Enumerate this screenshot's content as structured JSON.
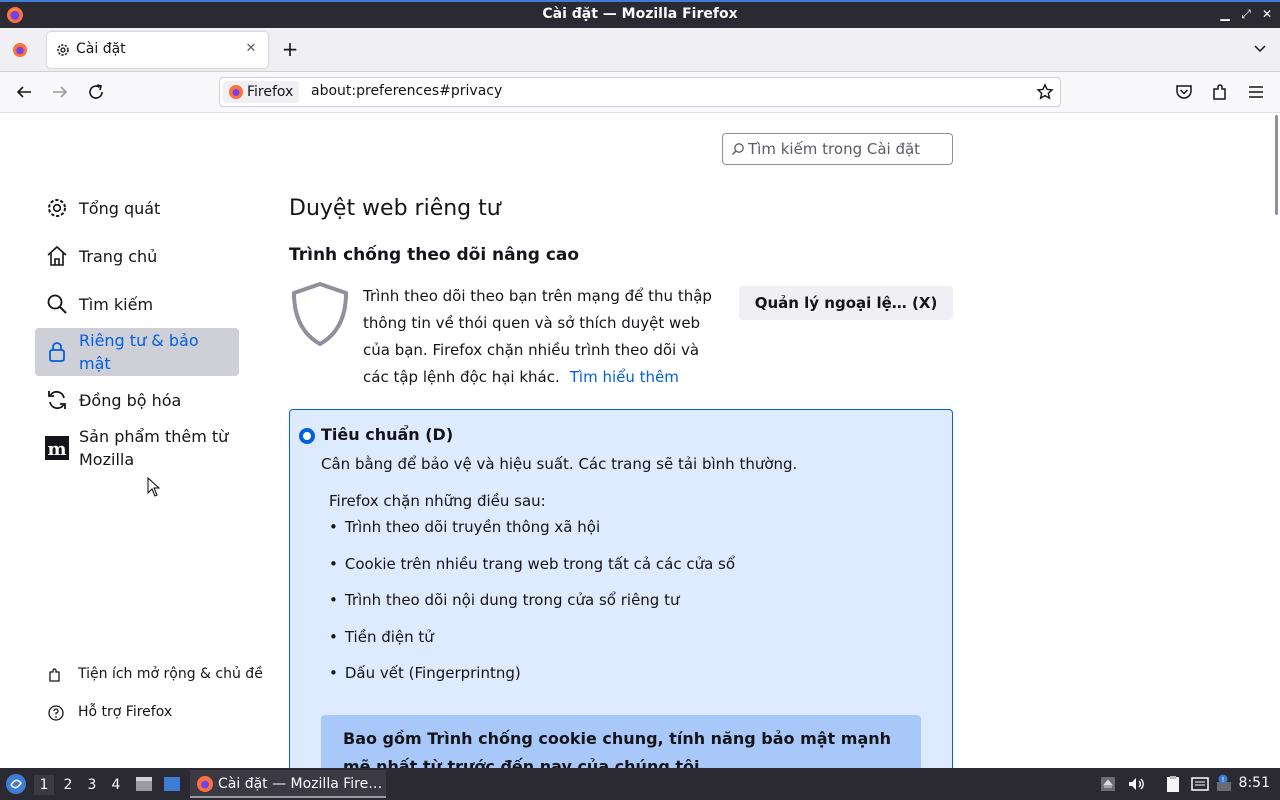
{
  "window": {
    "title": "Cài đặt — Mozilla Firefox"
  },
  "tabs": [
    {
      "label": "Cài đặt",
      "icon": "gear-icon",
      "active": true
    }
  ],
  "navbar": {
    "identity_label": "Firefox",
    "url": "about:preferences#privacy"
  },
  "search": {
    "placeholder": "Tìm kiếm trong Cài đặt"
  },
  "sidebar": {
    "categories": [
      {
        "label": "Tổng quát",
        "icon": "gear-icon"
      },
      {
        "label": "Trang chủ",
        "icon": "home-icon"
      },
      {
        "label": "Tìm kiếm",
        "icon": "search-icon"
      },
      {
        "label": "Riêng tư & bảo mật",
        "icon": "lock-icon",
        "selected": true
      },
      {
        "label": "Đồng bộ hóa",
        "icon": "sync-icon"
      },
      {
        "label": "Sản phẩm thêm từ Mozilla",
        "icon": "mozilla-m-icon"
      }
    ],
    "footer": [
      {
        "label": "Tiện ích mở rộng & chủ đề",
        "icon": "puzzle-icon"
      },
      {
        "label": "Hỗ trợ Firefox",
        "icon": "help-icon"
      }
    ]
  },
  "main": {
    "heading": "Duyệt web riêng tư",
    "subheading": "Trình chống theo dõi nâng cao",
    "description": "Trình theo dõi theo bạn trên mạng để thu thập thông tin về thói quen và sở thích duyệt web của bạn. Firefox chặn nhiều trình theo dõi và các tập lệnh độc hại khác.",
    "learn_more": "Tìm hiểu thêm",
    "manage_button": "Quản lý ngoại lệ… (X)",
    "standard": {
      "label": "Tiêu chuẩn (D)",
      "description": "Cân bằng để bảo vệ và hiệu suất. Các trang sẽ tải bình thường.",
      "blocks_intro": "Firefox chặn những điều sau:",
      "blocked_items": [
        "Trình theo dõi truyền thông xã hội",
        "Cookie trên nhiều trang web trong tất cả các cửa sổ",
        "Trình theo dõi nội dung trong cửa sổ riêng tư",
        "Tiền điện tử",
        "Dấu vết (Fingerprintng)"
      ],
      "tcp_note": "Bao gồm Trình chống cookie chung, tính năng bảo mật mạnh mẽ nhất từ trước đến nay của chúng tôi"
    }
  },
  "taskbar": {
    "workspaces": [
      "1",
      "2",
      "3",
      "4"
    ],
    "task_label": "Cài đặt — Mozilla Fire…",
    "clock": "8:51"
  },
  "colors": {
    "accent": "#0061e0",
    "selected_bg": "#cfcfd8",
    "box_bg": "#deeafd",
    "chrome_dark": "#2b2a33"
  }
}
